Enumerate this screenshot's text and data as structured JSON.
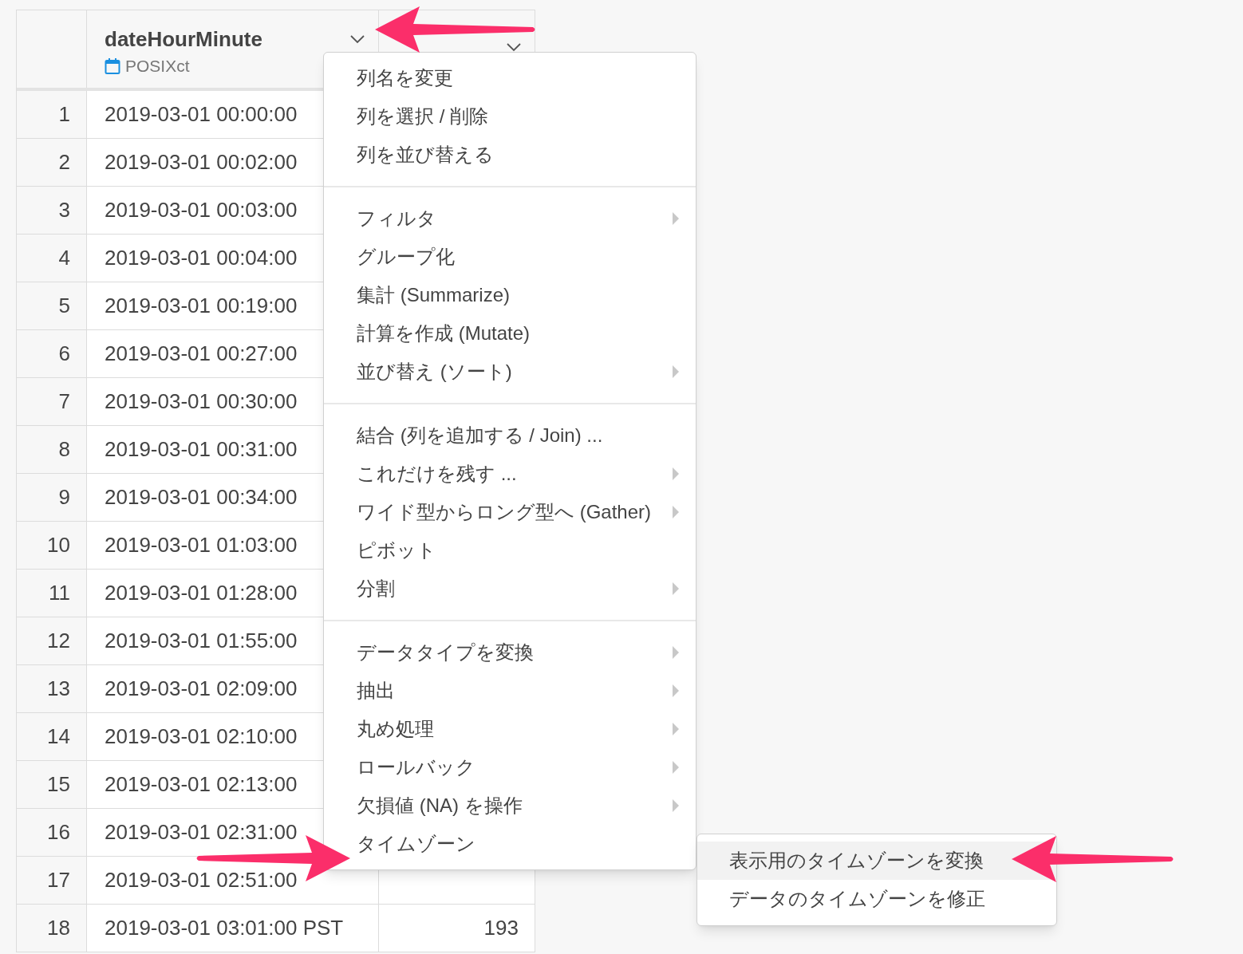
{
  "table": {
    "header": {
      "column_1": {
        "name": "dateHourMinute",
        "type": "POSIXct"
      }
    },
    "rows": [
      {
        "index": "1",
        "column_1": "2019-03-01 00:00:00"
      },
      {
        "index": "2",
        "column_1": "2019-03-01 00:02:00"
      },
      {
        "index": "3",
        "column_1": "2019-03-01 00:03:00"
      },
      {
        "index": "4",
        "column_1": "2019-03-01 00:04:00"
      },
      {
        "index": "5",
        "column_1": "2019-03-01 00:19:00"
      },
      {
        "index": "6",
        "column_1": "2019-03-01 00:27:00"
      },
      {
        "index": "7",
        "column_1": "2019-03-01 00:30:00"
      },
      {
        "index": "8",
        "column_1": "2019-03-01 00:31:00"
      },
      {
        "index": "9",
        "column_1": "2019-03-01 00:34:00"
      },
      {
        "index": "10",
        "column_1": "2019-03-01 01:03:00"
      },
      {
        "index": "11",
        "column_1": "2019-03-01 01:28:00"
      },
      {
        "index": "12",
        "column_1": "2019-03-01 01:55:00"
      },
      {
        "index": "13",
        "column_1": "2019-03-01 02:09:00"
      },
      {
        "index": "14",
        "column_1": "2019-03-01 02:10:00"
      },
      {
        "index": "15",
        "column_1": "2019-03-01 02:13:00"
      },
      {
        "index": "16",
        "column_1": "2019-03-01 02:31:00"
      },
      {
        "index": "17",
        "column_1": "2019-03-01 02:51:00"
      },
      {
        "index": "18",
        "column_1": "2019-03-01 03:01:00 PST",
        "column_2": "193"
      }
    ]
  },
  "context_menu": {
    "groups": [
      [
        {
          "label": "列名を変更",
          "has_submenu": false
        },
        {
          "label": "列を選択 / 削除",
          "has_submenu": false
        },
        {
          "label": "列を並び替える",
          "has_submenu": false
        }
      ],
      [
        {
          "label": "フィルタ",
          "has_submenu": true
        },
        {
          "label": "グループ化",
          "has_submenu": false
        },
        {
          "label": "集計 (Summarize)",
          "has_submenu": false
        },
        {
          "label": "計算を作成 (Mutate)",
          "has_submenu": false
        },
        {
          "label": "並び替え (ソート)",
          "has_submenu": true
        }
      ],
      [
        {
          "label": "結合 (列を追加する / Join) ...",
          "has_submenu": false
        },
        {
          "label": "これだけを残す ...",
          "has_submenu": true
        },
        {
          "label": "ワイド型からロング型へ (Gather)",
          "has_submenu": true
        },
        {
          "label": "ピボット",
          "has_submenu": false
        },
        {
          "label": "分割",
          "has_submenu": true
        }
      ],
      [
        {
          "label": "データタイプを変換",
          "has_submenu": true
        },
        {
          "label": "抽出",
          "has_submenu": true
        },
        {
          "label": "丸め処理",
          "has_submenu": true
        },
        {
          "label": "ロールバック",
          "has_submenu": true
        },
        {
          "label": "欠損値 (NA) を操作",
          "has_submenu": true
        },
        {
          "label": "タイムゾーン",
          "has_submenu": false
        }
      ]
    ]
  },
  "submenu": {
    "items": [
      {
        "label": "表示用のタイムゾーンを変換",
        "selected": true
      },
      {
        "label": "データのタイムゾーンを修正",
        "selected": false
      }
    ]
  }
}
